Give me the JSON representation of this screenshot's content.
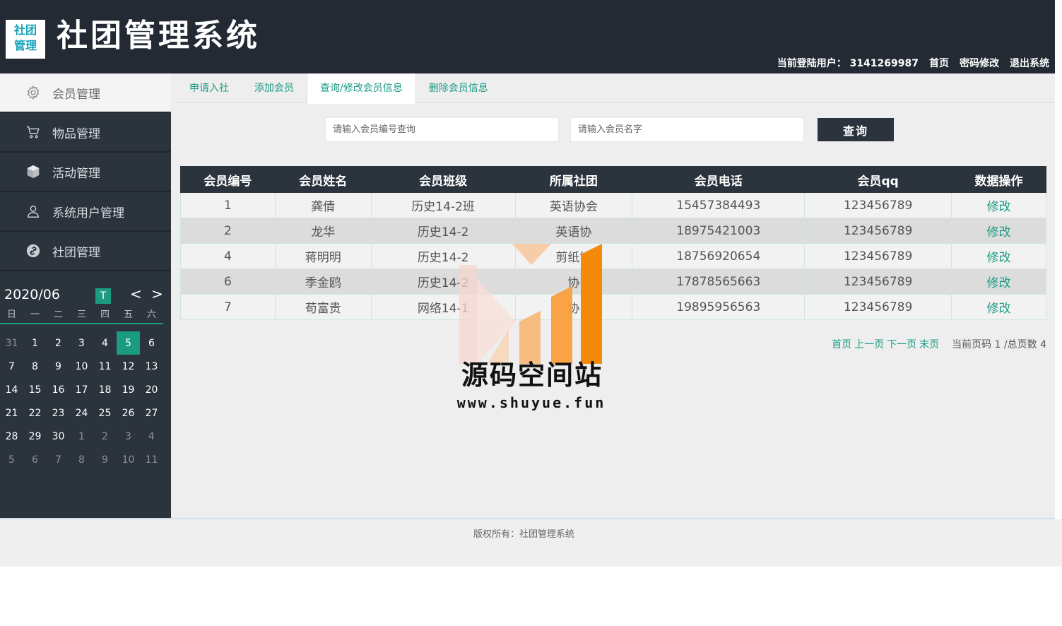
{
  "header": {
    "logo_line1": "社团",
    "logo_line2": "管理",
    "title": "社团管理系统",
    "user_label": "当前登陆用户：",
    "user_id": "3141269987",
    "nav_home": "首页",
    "nav_change_password": "密码修改",
    "nav_logout": "退出系统"
  },
  "sidebar": {
    "items": [
      {
        "label": "会员管理",
        "icon": "gear-icon",
        "active": true
      },
      {
        "label": "物品管理",
        "icon": "cart-icon",
        "active": false
      },
      {
        "label": "活动管理",
        "icon": "cube-icon",
        "active": false
      },
      {
        "label": "系统用户管理",
        "icon": "user-icon",
        "active": false
      },
      {
        "label": "社团管理",
        "icon": "link-icon",
        "active": false
      }
    ]
  },
  "calendar": {
    "month_label": "2020/06",
    "today_button": "T",
    "prev": "<",
    "next": ">",
    "weekdays": [
      "日",
      "一",
      "二",
      "三",
      "四",
      "五",
      "六"
    ],
    "days": [
      {
        "d": "31",
        "other": true
      },
      {
        "d": "1"
      },
      {
        "d": "2"
      },
      {
        "d": "3"
      },
      {
        "d": "4"
      },
      {
        "d": "5",
        "today": true
      },
      {
        "d": "6"
      },
      {
        "d": "7"
      },
      {
        "d": "8"
      },
      {
        "d": "9"
      },
      {
        "d": "10"
      },
      {
        "d": "11"
      },
      {
        "d": "12"
      },
      {
        "d": "13"
      },
      {
        "d": "14"
      },
      {
        "d": "15"
      },
      {
        "d": "16"
      },
      {
        "d": "17"
      },
      {
        "d": "18"
      },
      {
        "d": "19"
      },
      {
        "d": "20"
      },
      {
        "d": "21"
      },
      {
        "d": "22"
      },
      {
        "d": "23"
      },
      {
        "d": "24"
      },
      {
        "d": "25"
      },
      {
        "d": "26"
      },
      {
        "d": "27"
      },
      {
        "d": "28"
      },
      {
        "d": "29"
      },
      {
        "d": "30"
      },
      {
        "d": "1",
        "other": true
      },
      {
        "d": "2",
        "other": true
      },
      {
        "d": "3",
        "other": true
      },
      {
        "d": "4",
        "other": true
      },
      {
        "d": "5",
        "other": true
      },
      {
        "d": "6",
        "other": true
      },
      {
        "d": "7",
        "other": true
      },
      {
        "d": "8",
        "other": true
      },
      {
        "d": "9",
        "other": true
      },
      {
        "d": "10",
        "other": true
      },
      {
        "d": "11",
        "other": true
      }
    ]
  },
  "tabs": [
    {
      "label": "申请入社",
      "active": false
    },
    {
      "label": "添加会员",
      "active": false
    },
    {
      "label": "查询/修改会员信息",
      "active": true
    },
    {
      "label": "删除会员信息",
      "active": false
    }
  ],
  "search": {
    "id_placeholder": "请输入会员编号查询",
    "name_placeholder": "请输入会员名字",
    "button_label": "查询"
  },
  "table": {
    "headers": [
      "会员编号",
      "会员姓名",
      "会员班级",
      "所属社团",
      "会员电话",
      "会员qq",
      "数据操作"
    ],
    "rows": [
      [
        "1",
        "龚倩",
        "历史14-2班",
        "英语协会",
        "15457384493",
        "123456789",
        "修改"
      ],
      [
        "2",
        "龙华",
        "历史14-2",
        "英语协",
        "18975421003",
        "123456789",
        "修改"
      ],
      [
        "4",
        "蒋明明",
        "历史14-2",
        "剪纸协",
        "18756920654",
        "123456789",
        "修改"
      ],
      [
        "6",
        "季金鸥",
        "历史14-2",
        "协",
        "17878565663",
        "123456789",
        "修改"
      ],
      [
        "7",
        "苟富贵",
        "网络14-1",
        "协",
        "19895956563",
        "123456789",
        "修改"
      ]
    ]
  },
  "pager": {
    "first": "首页",
    "prev": "上一页",
    "next": "下一页",
    "last": "末页",
    "info": "当前页码 1 /总页数 4"
  },
  "watermark": {
    "text": "源码空间站",
    "url": "www.shuyue.fun"
  },
  "footer": {
    "copyright": "版权所有：社团管理系统"
  },
  "colors": {
    "accent": "#1c9b83",
    "dark": "#232a33",
    "sidebar": "#2b333d"
  }
}
